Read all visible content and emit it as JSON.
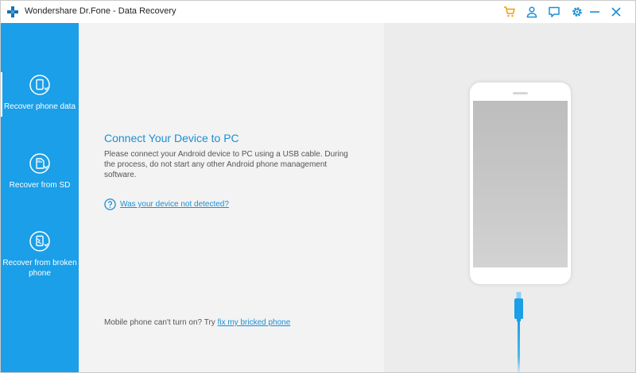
{
  "app": {
    "title": "Wondershare Dr.Fone - Data Recovery",
    "accent_color": "#1a9fe8",
    "cart_color": "#f39c12"
  },
  "titlebar": {
    "icons": [
      "cart-icon",
      "user-icon",
      "feedback-icon",
      "settings-icon",
      "minimize-icon",
      "close-icon"
    ]
  },
  "sidebar": {
    "items": [
      {
        "label": "Recover phone data",
        "icon": "phone-recover-icon",
        "selected": true
      },
      {
        "label": "Recover from SD",
        "icon": "sd-card-recover-icon",
        "selected": false
      },
      {
        "label": "Recover from broken phone",
        "icon": "broken-phone-recover-icon",
        "selected": false
      }
    ]
  },
  "main": {
    "heading": "Connect Your Device to PC",
    "description": "Please connect your Android device to PC using a USB cable. During the process, do not start any other Android phone management software.",
    "help_link": "Was your device not detected?",
    "bottom_note": "Mobile phone can't turn on? Try ",
    "bottom_link": "fix my bricked phone"
  }
}
